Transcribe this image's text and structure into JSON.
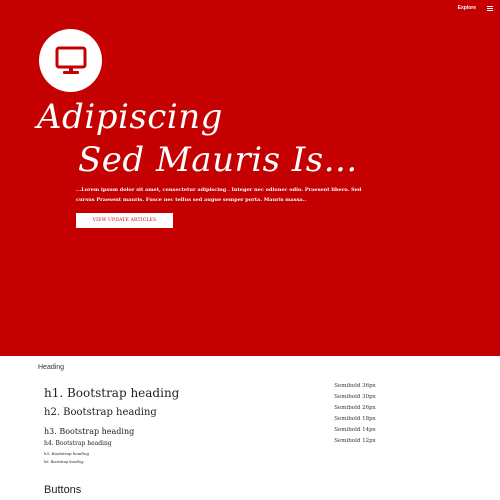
{
  "nav": {
    "explore_label": "Explore",
    "menu_icon": "hamburger-icon"
  },
  "hero": {
    "icon": "monitor-icon",
    "title_line1": "Adipiscing",
    "title_line2": "Sed Mauris Is...",
    "description": "...Lorem ipsum dolor sit amet, consectetur adipiscing . Integer nec odionec odio. Praesent libero. Sed cursus Praesent mauris. Fusce nec tellus sed augue semper porta. Mauris massa..",
    "button_label": "VIEW UPDATE ARTICLES"
  },
  "heading_section": {
    "title": "Heading",
    "h1": "h1. Bootstrap heading",
    "h2": "h2. Bootstrap heading",
    "h3": "h3. Bootstrap heading",
    "h4": "h4. Bootstrap heading",
    "h5": "h5. Bootstrap heading",
    "h6": "h6. Bootstrap heading",
    "sizes": [
      "Semibold 36px",
      "Semibold 30px",
      "Semibold 26px",
      "Semibold 18px",
      "Semibold 14px",
      "Semibold 12px"
    ]
  },
  "buttons_section": {
    "title": "Buttons"
  },
  "colors": {
    "hero_background": "#c50000",
    "text_on_hero": "#ffffff"
  }
}
